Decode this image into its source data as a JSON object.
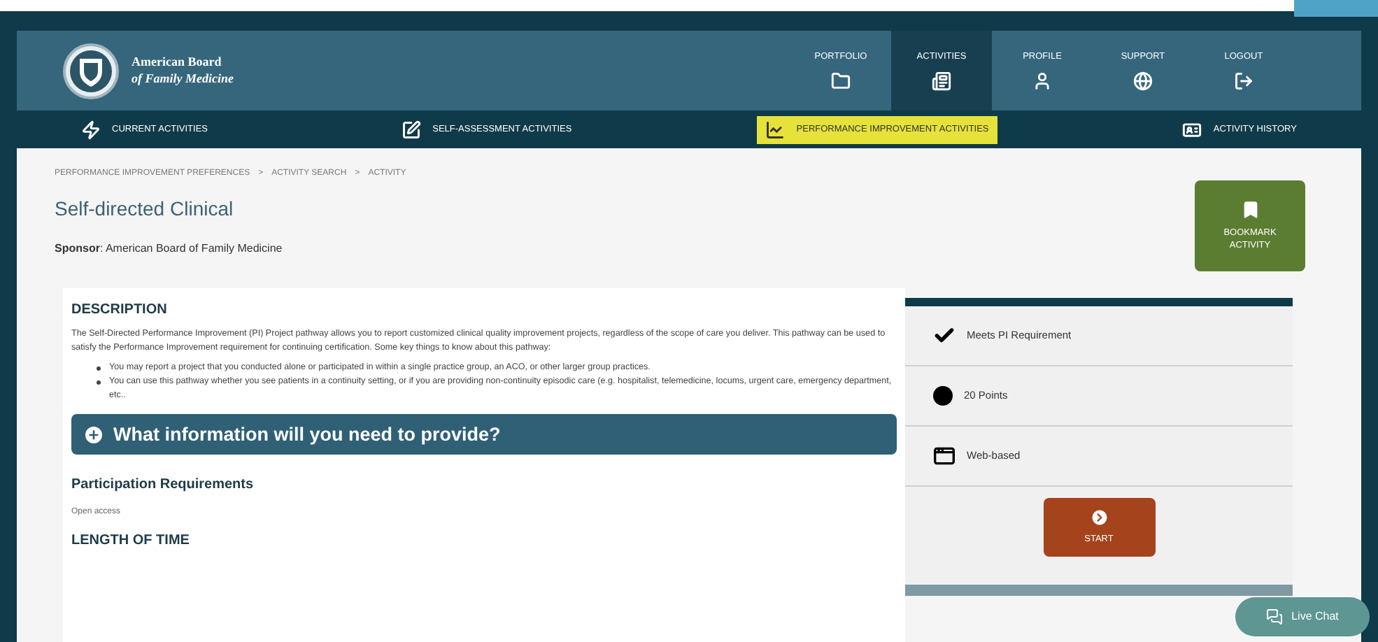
{
  "logo": {
    "line1": "American Board",
    "line2": "of Family Medicine"
  },
  "nav": [
    {
      "label": "PORTFOLIO",
      "selected": false
    },
    {
      "label": "ACTIVITIES",
      "selected": true
    },
    {
      "label": "PROFILE",
      "selected": false
    },
    {
      "label": "SUPPORT",
      "selected": false
    },
    {
      "label": "LOGOUT",
      "selected": false
    }
  ],
  "subnav": [
    {
      "label": "CURRENT ACTIVITIES",
      "selected": false
    },
    {
      "label": "SELF-ASSESSMENT ACTIVITIES",
      "selected": false
    },
    {
      "label": "PERFORMANCE IMPROVEMENT ACTIVITIES",
      "selected": true
    },
    {
      "label": "ACTIVITY HISTORY",
      "selected": false
    }
  ],
  "breadcrumbs": [
    "PERFORMANCE IMPROVEMENT PREFERENCES",
    "ACTIVITY SEARCH",
    "ACTIVITY"
  ],
  "breadcrumb_separator": ">",
  "title": "Self-directed Clinical",
  "sponsor": "**Sponsor**: American Board of Family Medicine",
  "bookmark_button": "BOOKMARK ACTIVITY",
  "description": {
    "heading": "DESCRIPTION",
    "text": "The Self-Directed Performance Improvement (PI) Project pathway allows you to report customized clinical quality improvement projects, regardless of the scope of care you deliver. This pathway can be used to satisfy the Performance Improvement requirement for continuing certification. Some key things to know about this pathway:",
    "bullets": [
      "You may report a project that you conducted alone or participated in within a single practice group, an ACO, or other larger group practices.",
      "You can use this pathway whether you see patients in a continuity setting, or if you are providing non-continuity episodic care (e.g. hospitalist, telemedicine, locums, urgent care, emergency department, etc.."
    ]
  },
  "accordion": {
    "label": "What information will you need to provide?",
    "expanded": false
  },
  "participation": {
    "heading": "Participation Requirements",
    "text": "Open access"
  },
  "length_heading": "LENGTH OF TIME",
  "features": [
    {
      "kind": "check",
      "label": "Meets PI Requirement"
    },
    {
      "kind": "points",
      "label": "20 Points"
    },
    {
      "kind": "format",
      "label": "Web-based"
    }
  ],
  "start_button": "START",
  "live_chat": "Live Chat"
}
